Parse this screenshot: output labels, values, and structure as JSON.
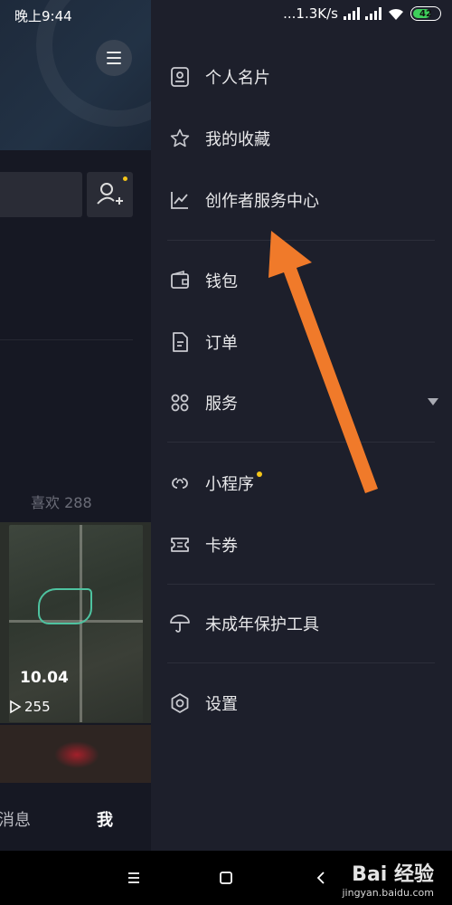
{
  "status_bar": {
    "time": "晚上9:44",
    "network_speed": "...1.3K/s",
    "battery_level": "42"
  },
  "profile_page": {
    "likes_label": "喜欢 288",
    "run_distance": "10.04",
    "play_count": "255",
    "tabs": {
      "messages": "消息",
      "me": "我"
    }
  },
  "drawer": {
    "items": [
      {
        "label": "个人名片",
        "icon": "profile-card-icon"
      },
      {
        "label": "我的收藏",
        "icon": "star-icon"
      },
      {
        "label": "创作者服务中心",
        "icon": "chart-line-icon"
      },
      {
        "label": "钱包",
        "icon": "wallet-icon"
      },
      {
        "label": "订单",
        "icon": "order-icon"
      },
      {
        "label": "服务",
        "icon": "grid-icon"
      },
      {
        "label": "小程序",
        "icon": "mini-program-icon"
      },
      {
        "label": "卡券",
        "icon": "ticket-icon"
      },
      {
        "label": "未成年保护工具",
        "icon": "umbrella-icon"
      },
      {
        "label": "设置",
        "icon": "gear-icon"
      }
    ]
  },
  "watermark": {
    "logo": "Bai 经验",
    "sub": "jingyan.baidu.com"
  },
  "colors": {
    "drawer_bg": "#1d1f2b",
    "page_bg": "#161823",
    "arrow": "#f07a2a",
    "badge": "#f5c518"
  }
}
